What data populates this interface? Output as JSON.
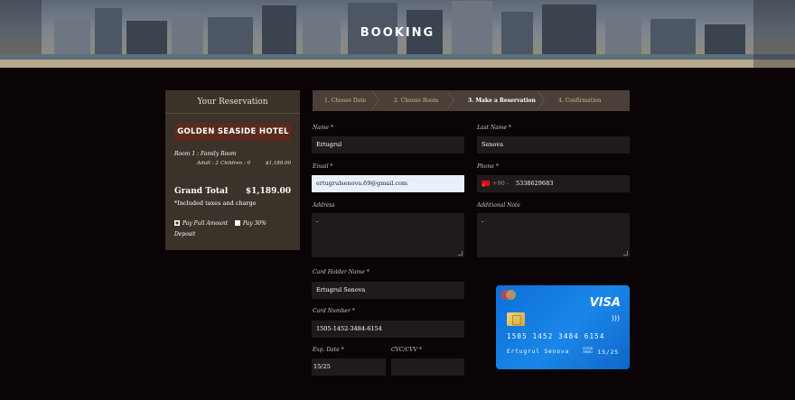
{
  "hero": {
    "title": "BOOKING"
  },
  "reservation": {
    "heading": "Your Reservation",
    "hotel_name": "GOLDEN SEASIDE HOTEL",
    "room_line": "Room 1 : Family Room",
    "adult": "Adult : 2",
    "children": "Children : 0",
    "room_price": "$1,189.00",
    "grand_total_label": "Grand Total",
    "grand_total_value": "$1,189.00",
    "taxes_note": "*Included taxes and charge",
    "pay_full_label": "Pay Full Amount",
    "pay_deposit_label": "Pay 30%",
    "pay_deposit_label_2": "Deposit"
  },
  "steps": [
    {
      "label": "1. Choose Date"
    },
    {
      "label": "2. Choose Room"
    },
    {
      "label": "3. Make a Reservation"
    },
    {
      "label": "4. Confirmation"
    }
  ],
  "form": {
    "name_label": "Name *",
    "name_value": "Ertugrul",
    "lastname_label": "Last Name *",
    "lastname_value": "Senova",
    "email_label": "Email *",
    "email_value": "ertugrulsenova.69@gmail.com",
    "phone_label": "Phone *",
    "phone_code": "+90 -",
    "phone_value": "5338629683",
    "address_label": "Address",
    "address_value": "-",
    "note_label": "Additional Note",
    "note_value": "-",
    "card_holder_label": "Card Holder Name *",
    "card_holder_value": "Ertugrul Senova",
    "card_number_label": "Card Number *",
    "card_number_value": "1505-1452-3484-6154",
    "exp_label": "Exp. Date *",
    "exp_value": "15/25",
    "cvc_label": "CVC/CVV *",
    "cvc_value": ""
  },
  "card": {
    "brand": "VISA",
    "number": "1505 1452 3484 6154",
    "holder": "Ertugrul Senova",
    "good_thru": "GOOD\nTHRU",
    "expiry": "15/25",
    "colors": {
      "card_blue": "#0d6fd8"
    }
  },
  "colors": {
    "panel": "#3b3229",
    "badge": "#5a2a1e",
    "field": "#201b1b",
    "accent": "#c9b99a"
  }
}
